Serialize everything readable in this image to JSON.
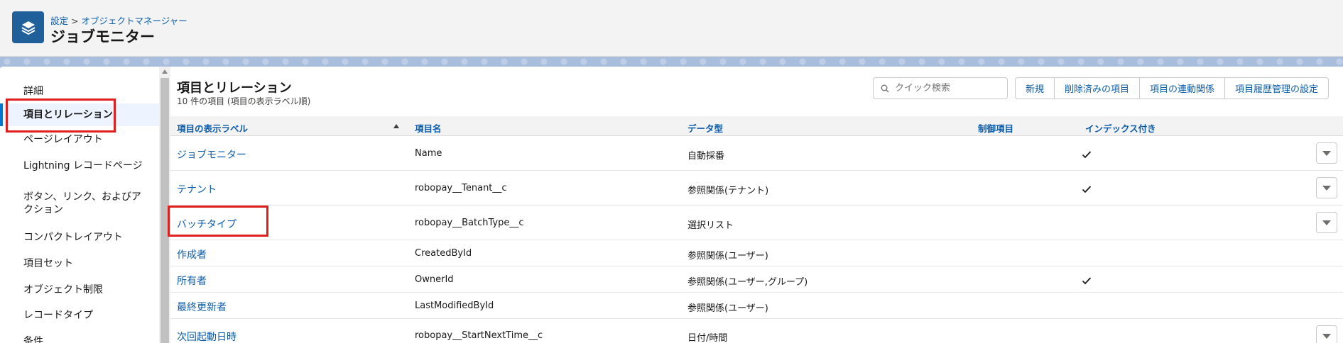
{
  "header": {
    "breadcrumb": [
      "設定",
      "オブジェクトマネージャー"
    ],
    "breadcrumb_sep": ">",
    "title": "ジョブモニター",
    "icon": "stack-layers-icon"
  },
  "sidebar": {
    "items": [
      {
        "label": "詳細"
      },
      {
        "label": "項目とリレーション",
        "active": true
      },
      {
        "label": "ページレイアウト"
      },
      {
        "label": "Lightning レコードページ"
      },
      {
        "label": "ボタン、リンク、およびア"
      },
      {
        "label": "クション"
      },
      {
        "label": "コンパクトレイアウト"
      },
      {
        "label": "項目セット"
      },
      {
        "label": "オブジェクト制限"
      },
      {
        "label": "レコードタイプ"
      },
      {
        "label": "条件"
      }
    ]
  },
  "main": {
    "title": "項目とリレーション",
    "subtitle": "10 件の項目 (項目の表示ラベル順)",
    "search_placeholder": "クイック検索",
    "buttons": [
      "新規",
      "削除済みの項目",
      "項目の連動関係",
      "項目履歴管理の設定"
    ],
    "columns": [
      "項目の表示ラベル",
      "項目名",
      "データ型",
      "制御項目",
      "インデックス付き"
    ],
    "rows": [
      {
        "label": "ジョブモニター",
        "api": "Name",
        "type": "自動採番",
        "indexed": true,
        "menu": true
      },
      {
        "label": "テナント",
        "api": "robopay__Tenant__c",
        "type": "参照関係(テナント)",
        "indexed": true,
        "menu": true
      },
      {
        "label": "バッチタイプ",
        "api": "robopay__BatchType__c",
        "type": "選択リスト",
        "indexed": false,
        "menu": true
      },
      {
        "label": "作成者",
        "api": "CreatedById",
        "type": "参照関係(ユーザー)",
        "indexed": false,
        "menu": false
      },
      {
        "label": "所有者",
        "api": "OwnerId",
        "type": "参照関係(ユーザー,グループ)",
        "indexed": true,
        "menu": false
      },
      {
        "label": "最終更新者",
        "api": "LastModifiedById",
        "type": "参照関係(ユーザー)",
        "indexed": false,
        "menu": false
      },
      {
        "label": "次回起動日時",
        "api": "robopay__StartNextTime__c",
        "type": "日付/時間",
        "indexed": false,
        "menu": true
      }
    ]
  },
  "colors": {
    "link": "#0b5cab",
    "brand_icon": "#1f5f9a",
    "highlight": "#e01e1e",
    "active_nav": "#0176d3"
  }
}
